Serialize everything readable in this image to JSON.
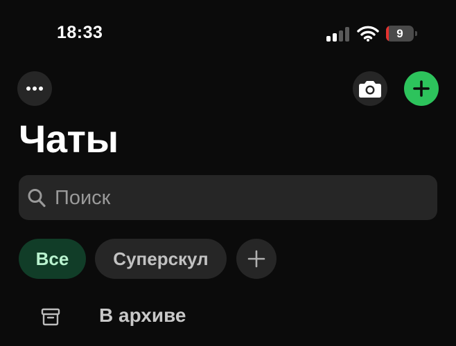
{
  "status_bar": {
    "time": "18:33",
    "battery_level": "9",
    "battery_color": "#e5322f",
    "signal_bars_active": 2,
    "icons": [
      "cellular-signal-icon",
      "wifi-icon",
      "battery-icon"
    ]
  },
  "header": {
    "more_icon": "ellipsis-icon",
    "camera_icon": "camera-icon",
    "new_chat_icon": "plus-icon",
    "new_chat_color": "#2dc35c",
    "title": "Чаты"
  },
  "search": {
    "placeholder": "Поиск",
    "value": "",
    "icon": "search-icon"
  },
  "filters": {
    "items": [
      {
        "label": "Все",
        "selected": true
      },
      {
        "label": "Суперскул",
        "selected": false
      }
    ],
    "add_icon": "plus-icon",
    "selected_color": "#113d28"
  },
  "archive": {
    "label": "В архиве",
    "icon": "archive-box-icon"
  }
}
